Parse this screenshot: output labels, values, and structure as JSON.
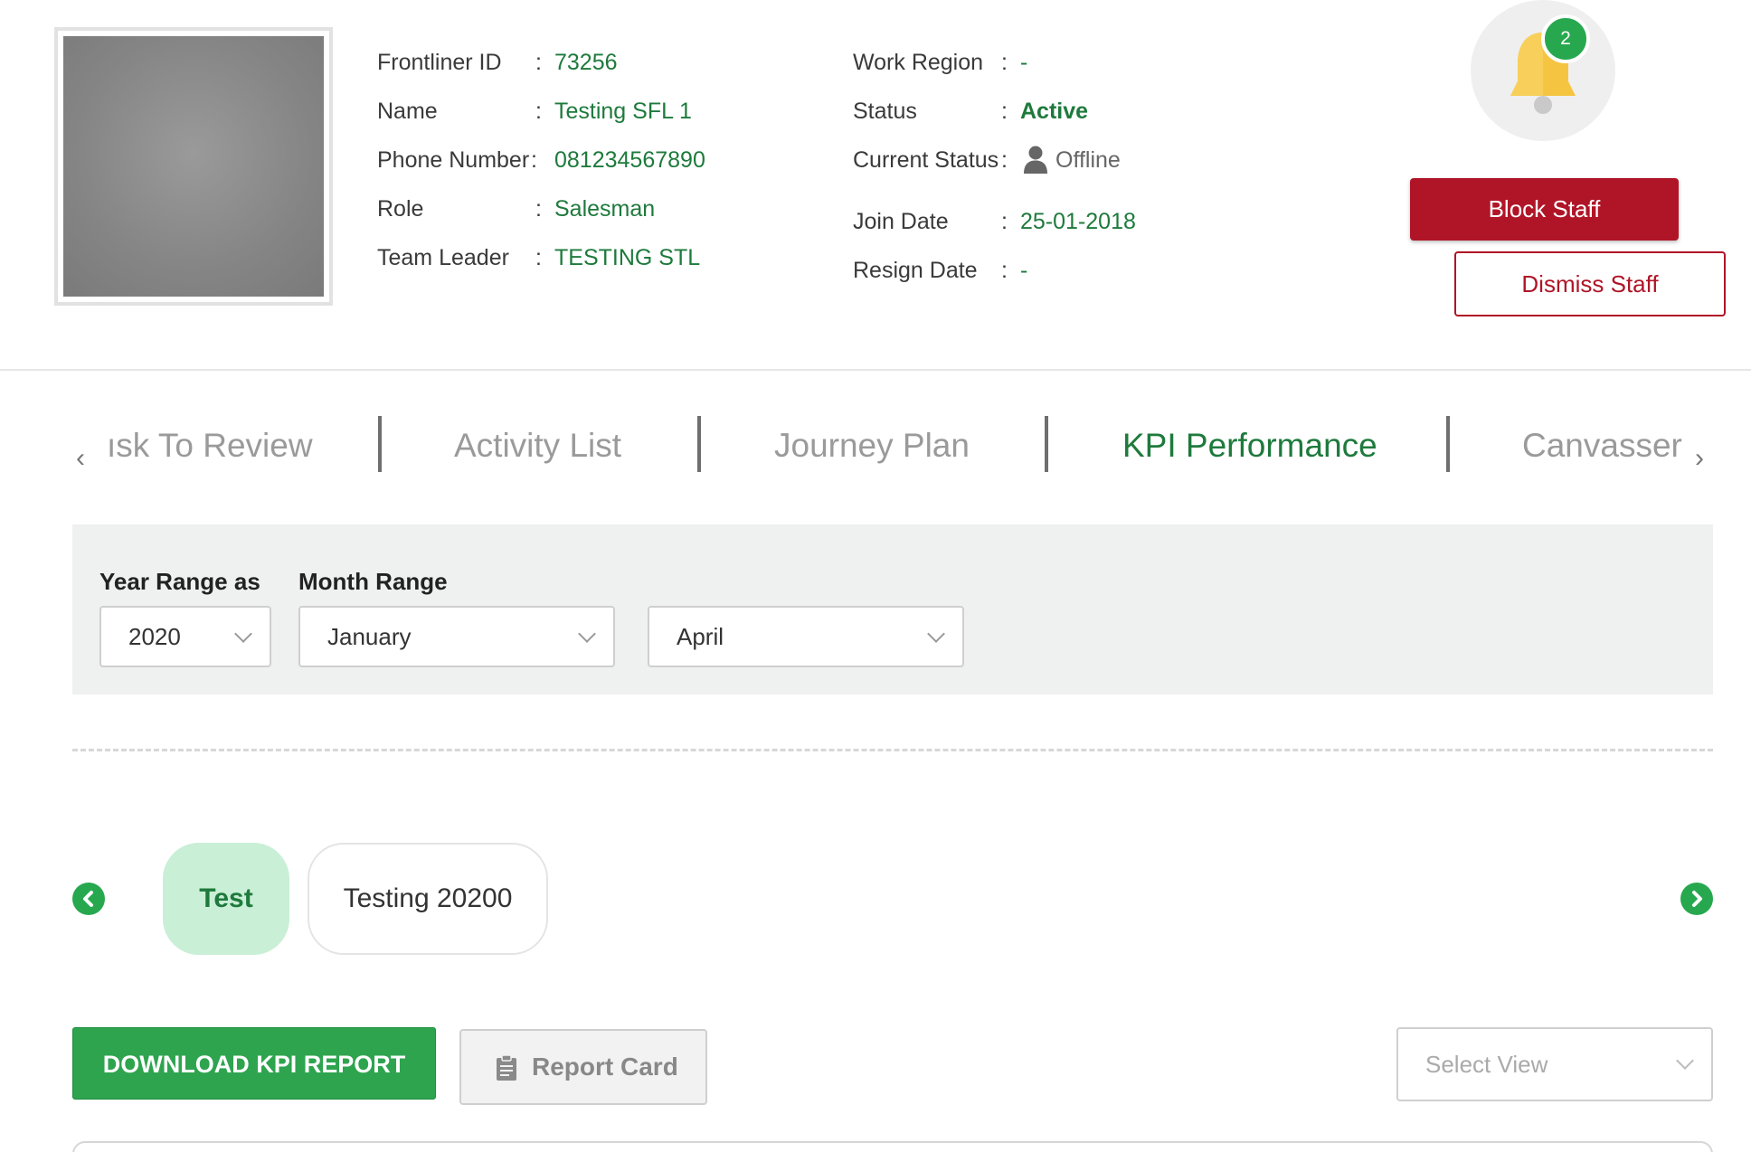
{
  "profile": {
    "labels": {
      "frontliner_id": "Frontliner ID",
      "name": "Name",
      "phone": "Phone Number",
      "role": "Role",
      "team_leader": "Team Leader",
      "work_region": "Work Region",
      "status": "Status",
      "current_status": "Current Status",
      "join_date": "Join Date",
      "resign_date": "Resign Date"
    },
    "values": {
      "frontliner_id": "73256",
      "name": "Testing SFL 1",
      "phone": "081234567890",
      "role": "Salesman",
      "team_leader": "TESTING STL",
      "work_region": "-",
      "status": "Active",
      "current_status": "Offline",
      "join_date": "25-01-2018",
      "resign_date": "-"
    },
    "colon": ":"
  },
  "notifications": {
    "count": "2"
  },
  "actions": {
    "block": "Block Staff",
    "dismiss": "Dismiss Staff"
  },
  "tabs": {
    "items": [
      "ısk To Review",
      "Activity List",
      "Journey Plan",
      "KPI Performance",
      "Canvasser"
    ],
    "active": "KPI Performance",
    "prev_arrow": "‹",
    "next_arrow": "›"
  },
  "filters": {
    "year_label": "Year Range as",
    "month_label": "Month Range",
    "year_value": "2020",
    "month_from": "January",
    "month_to": "April"
  },
  "kpi_groups": {
    "items": [
      "Test",
      "Testing 20200"
    ],
    "active": "Test"
  },
  "toolbar": {
    "download": "DOWNLOAD KPI REPORT",
    "report_card": "Report Card",
    "select_view_placeholder": "Select View"
  },
  "colors": {
    "accent_green": "#27a84f",
    "text_green": "#1e7a3c",
    "danger_red": "#b01527",
    "bell_yellow": "#f5c542"
  }
}
